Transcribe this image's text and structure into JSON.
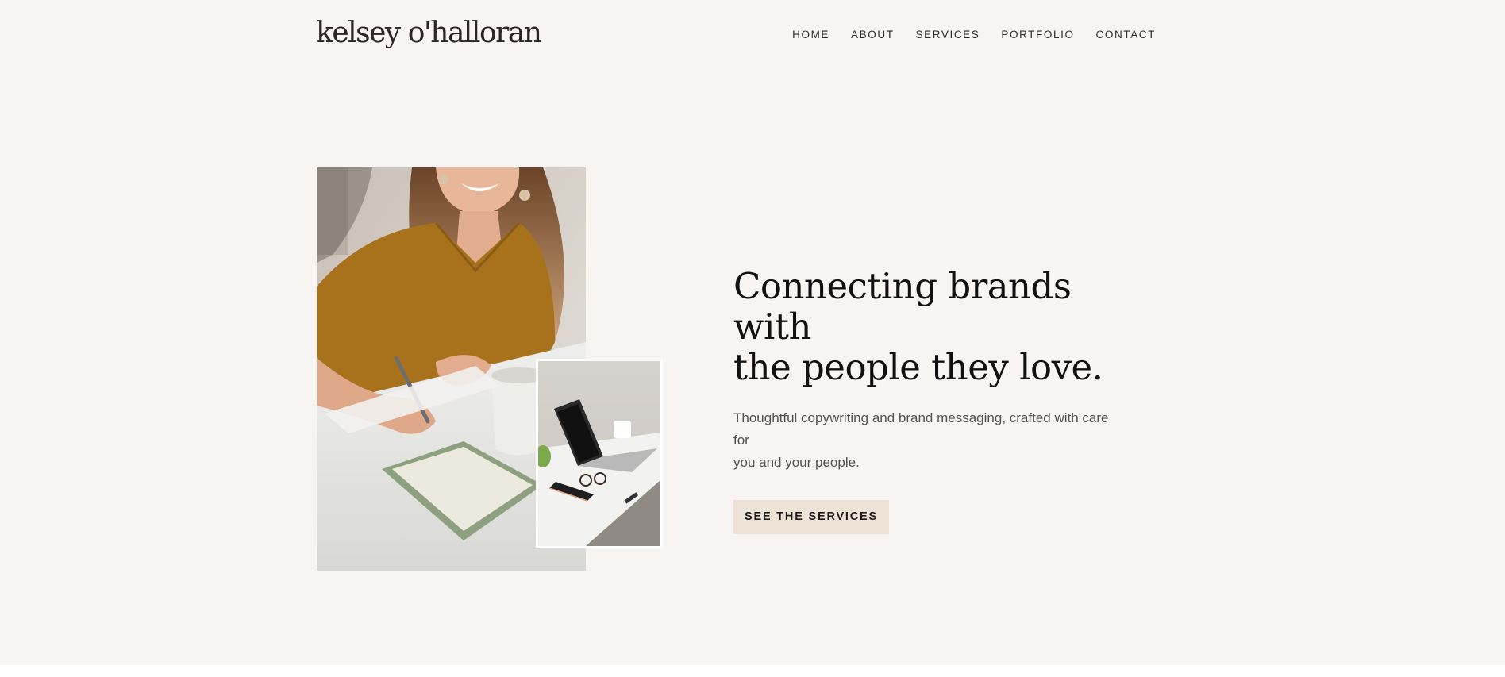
{
  "header": {
    "logo": "kelsey o'halloran",
    "nav": [
      {
        "label": "HOME"
      },
      {
        "label": "ABOUT"
      },
      {
        "label": "SERVICES"
      },
      {
        "label": "PORTFOLIO"
      },
      {
        "label": "CONTACT"
      }
    ]
  },
  "hero": {
    "title_line1": "Connecting brands with",
    "title_line2": "the people they love.",
    "subtitle_line1": "Thoughtful copywriting and brand messaging, crafted with care for",
    "subtitle_line2": "you and your people.",
    "cta_label": "SEE THE SERVICES"
  },
  "colors": {
    "background": "#f7f4f1",
    "cta_background": "#ece2d5",
    "text_dark": "#111111"
  }
}
